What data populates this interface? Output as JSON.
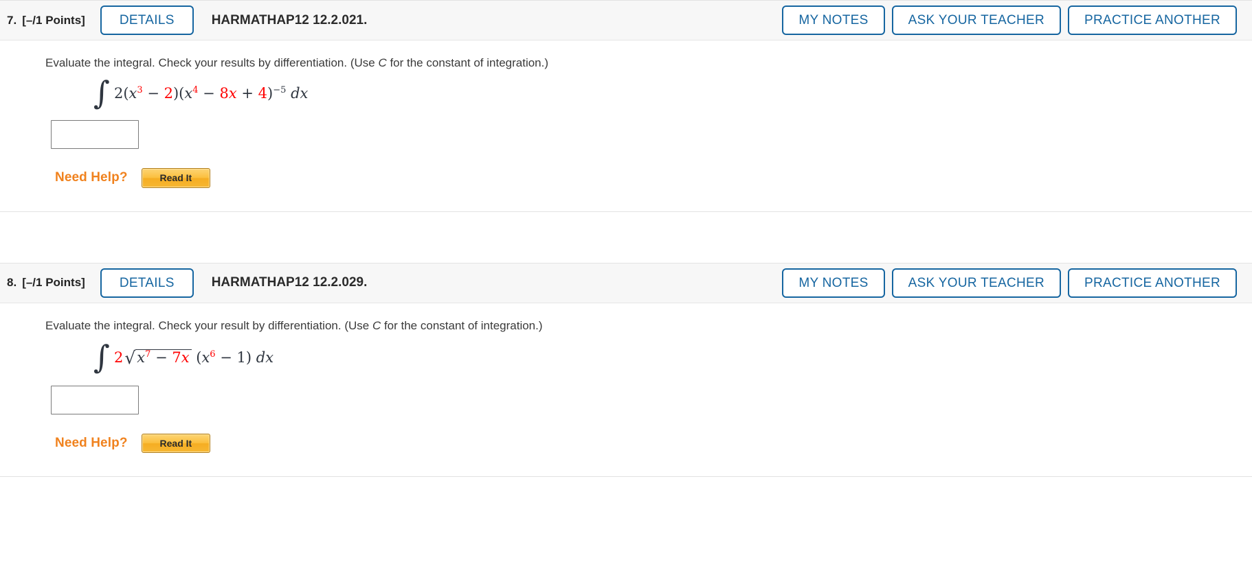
{
  "questions": [
    {
      "number": "7.",
      "points": "[–/1 Points]",
      "details_label": "DETAILS",
      "code": "HARMATHAP12 12.2.021.",
      "actions": [
        {
          "label": "MY NOTES",
          "name": "my-notes-button"
        },
        {
          "label": "ASK YOUR TEACHER",
          "name": "ask-your-teacher-button"
        },
        {
          "label": "PRACTICE ANOTHER",
          "name": "practice-another-button"
        }
      ],
      "statement_prefix": "Evaluate the integral. Check your results by differentiation. (Use ",
      "statement_italic": "C",
      "statement_suffix": " for the constant of integration.)",
      "math": {
        "integral_sign": "∫",
        "parts": [
          {
            "t": "2(",
            "red": false,
            "italic": false
          },
          {
            "t": "x",
            "red": false,
            "italic": true
          },
          {
            "t": "3",
            "red": true,
            "sup": true
          },
          {
            "t": " − ",
            "red": false,
            "italic": false
          },
          {
            "t": "2",
            "red": true,
            "italic": false
          },
          {
            "t": ")(",
            "red": false,
            "italic": false
          },
          {
            "t": "x",
            "red": false,
            "italic": true
          },
          {
            "t": "4",
            "red": true,
            "sup": true
          },
          {
            "t": " − ",
            "red": false,
            "italic": false
          },
          {
            "t": "8",
            "red": true,
            "italic": false
          },
          {
            "t": "x",
            "red": true,
            "italic": true
          },
          {
            "t": " + ",
            "red": false,
            "italic": false
          },
          {
            "t": "4",
            "red": true,
            "italic": false
          },
          {
            "t": ")",
            "red": false,
            "italic": false
          },
          {
            "t": "−5",
            "red": false,
            "sup": true
          },
          {
            "t": " ",
            "red": false,
            "italic": false
          },
          {
            "t": "dx",
            "red": false,
            "italic": true
          }
        ]
      },
      "answer_value": "",
      "need_help_label": "Need Help?",
      "read_it_label": "Read It"
    },
    {
      "number": "8.",
      "points": "[–/1 Points]",
      "details_label": "DETAILS",
      "code": "HARMATHAP12 12.2.029.",
      "actions": [
        {
          "label": "MY NOTES",
          "name": "my-notes-button"
        },
        {
          "label": "ASK YOUR TEACHER",
          "name": "ask-your-teacher-button"
        },
        {
          "label": "PRACTICE ANOTHER",
          "name": "practice-another-button"
        }
      ],
      "statement_prefix": "Evaluate the integral. Check your result by differentiation. (Use ",
      "statement_italic": "C",
      "statement_suffix": " for the constant of integration.)",
      "math": {
        "integral_sign": "∫",
        "coefficient": "2",
        "radical_sign": "√",
        "radicand": [
          {
            "t": "x",
            "red": false,
            "italic": true
          },
          {
            "t": "7",
            "red": true,
            "sup": true
          },
          {
            "t": " − ",
            "red": false,
            "italic": false
          },
          {
            "t": "7",
            "red": true,
            "italic": false
          },
          {
            "t": "x",
            "red": true,
            "italic": true
          }
        ],
        "tail": [
          {
            "t": " (",
            "red": false,
            "italic": false
          },
          {
            "t": "x",
            "red": false,
            "italic": true
          },
          {
            "t": "6",
            "red": true,
            "sup": true
          },
          {
            "t": " − 1) ",
            "red": false,
            "italic": false
          },
          {
            "t": "dx",
            "red": false,
            "italic": true
          }
        ]
      },
      "answer_value": "",
      "need_help_label": "Need Help?",
      "read_it_label": "Read It"
    }
  ],
  "colors": {
    "accent_blue": "#1565a0",
    "math_red": "#ff0000",
    "help_orange": "#f0821e",
    "button_gold": "#fbbf3e"
  }
}
